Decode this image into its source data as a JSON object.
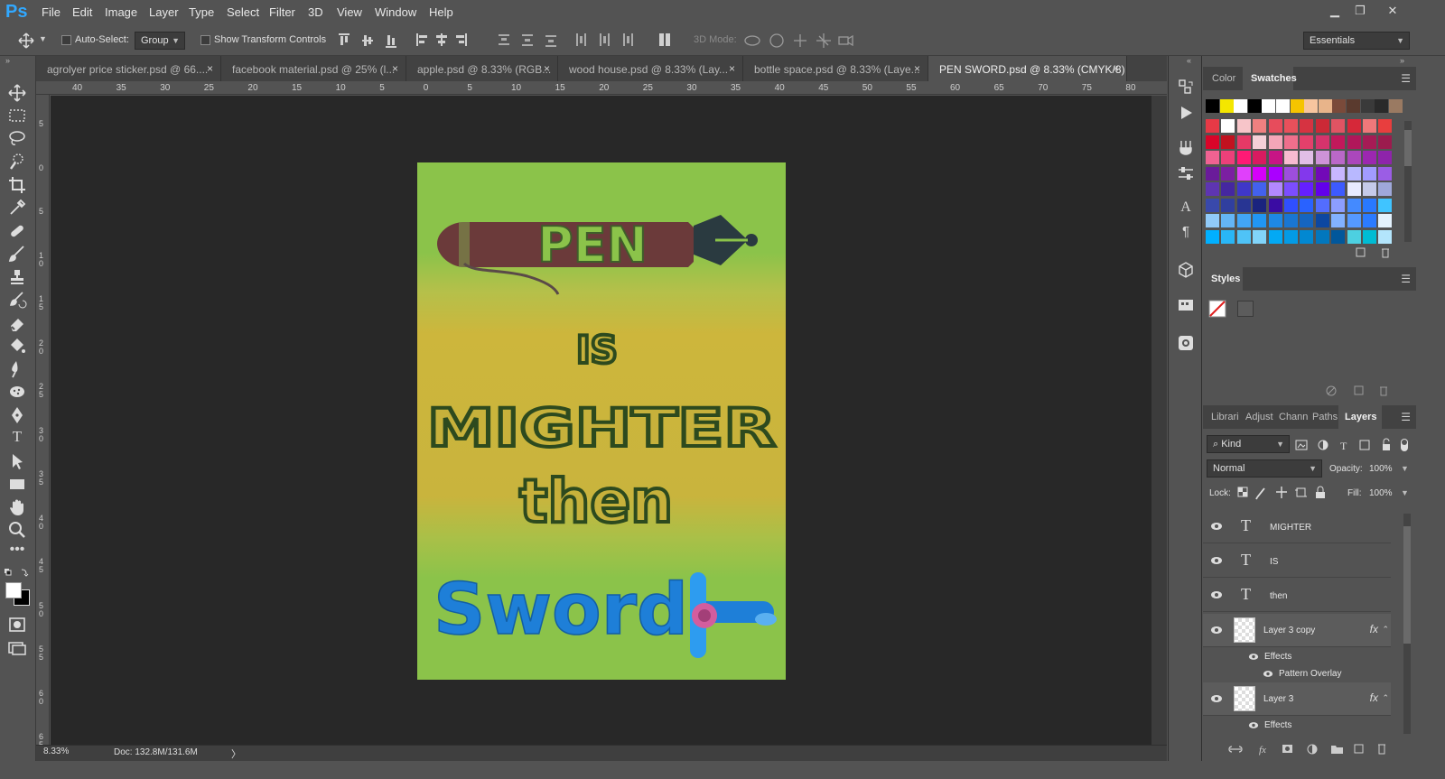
{
  "app": {
    "logo": "Ps"
  },
  "menu": [
    "File",
    "Edit",
    "Image",
    "Layer",
    "Type",
    "Select",
    "Filter",
    "3D",
    "View",
    "Window",
    "Help"
  ],
  "options": {
    "auto_select_label": "Auto-Select:",
    "auto_select_value": "Group",
    "show_transform_label": "Show Transform Controls",
    "mode_3d_label": "3D Mode:",
    "workspace": "Essentials"
  },
  "tabs": [
    {
      "label": "agrolyer price sticker.psd @ 66....",
      "active": false
    },
    {
      "label": "facebook material.psd @ 25% (l...",
      "active": false
    },
    {
      "label": "apple.psd @ 8.33% (RGB...",
      "active": false
    },
    {
      "label": "wood house.psd @ 8.33% (Lay...",
      "active": false
    },
    {
      "label": "bottle space.psd @ 8.33% (Laye...",
      "active": false
    },
    {
      "label": "PEN SWORD.psd @ 8.33% (CMYK/8)",
      "active": true
    }
  ],
  "tab_close": "×",
  "ruler": {
    "top": [
      "40",
      "35",
      "30",
      "25",
      "20",
      "15",
      "10",
      "5",
      "0",
      "5",
      "10",
      "15",
      "20",
      "25",
      "30",
      "35",
      "40",
      "45",
      "50",
      "55",
      "60",
      "65",
      "70",
      "75",
      "80"
    ],
    "left": [
      "5",
      "0",
      "5",
      "1\n0",
      "1\n5",
      "2\n0",
      "2\n5",
      "3\n0",
      "3\n5",
      "4\n0",
      "4\n5",
      "5\n0",
      "5\n5",
      "6\n0",
      "6\n5"
    ]
  },
  "artwork": {
    "pen_word": "PEN",
    "is_word": "IS",
    "mighter_word": "MIGHTER",
    "then_word": "then",
    "sword_word": "Sword"
  },
  "status": {
    "zoom": "8.33%",
    "doc": "Doc: 132.8M/131.6M",
    "arrow": "〉"
  },
  "panels": {
    "color_tabs": [
      "Color",
      "Swatches"
    ],
    "active_color_tab": "Swatches",
    "styles_tab": "Styles",
    "layer_tabs": [
      "Librari",
      "Adjust",
      "Chann",
      "Paths",
      "Layers"
    ],
    "active_layer_tab": "Layers",
    "filter_kind": "Kind",
    "blend_mode": "Normal",
    "opacity_label": "Opacity:",
    "opacity_value": "100%",
    "lock_label": "Lock:",
    "fill_label": "Fill:",
    "fill_value": "100%"
  },
  "swatch_row1": [
    "#000000",
    "#f4e600",
    "#ffffff",
    "#000000",
    "#ffffff",
    "#ffffff",
    "#f5c400",
    "#f7c59f",
    "#e8b48a",
    "#7a4a3a",
    "#5a3a2e",
    "#3a3a3a",
    "#2a2a2a",
    "#9a7a62"
  ],
  "swatches": [
    [
      "#e63946",
      "#ffffff",
      "#f7c5c9",
      "#f08080",
      "#e74c5c",
      "#e8505b",
      "#d63341",
      "#cc2936",
      "#e05463",
      "#d62839",
      "#f0787a",
      "#e83e3e"
    ],
    [
      "#d90429",
      "#c1121f",
      "#e63966",
      "#f5d0d8",
      "#f4a6b8",
      "#ef6f8c",
      "#e4406b",
      "#d6336c",
      "#c2185b",
      "#b0175a",
      "#a61b55",
      "#9c1b4e"
    ],
    [
      "#f06292",
      "#ec407a",
      "#ff1a75",
      "#d81b60",
      "#c71585",
      "#f8bbd0",
      "#e1bee7",
      "#ce93d8",
      "#ba68c8",
      "#ab47bc",
      "#9c27b0",
      "#8e24aa"
    ],
    [
      "#6a1b9a",
      "#7b1fa2",
      "#e040fb",
      "#d500f9",
      "#aa00ff",
      "#9d4edd",
      "#8338ec",
      "#7209b7",
      "#c8b6ff",
      "#b8b8ff",
      "#a29bfe",
      "#9b5de5"
    ],
    [
      "#5e35b1",
      "#4527a0",
      "#3f37c9",
      "#4361ee",
      "#b388ff",
      "#7c4dff",
      "#651fff",
      "#6200ea",
      "#3d5afe",
      "#e8eaff",
      "#c5cae9",
      "#9fa8da"
    ],
    [
      "#3949ab",
      "#303f9f",
      "#283593",
      "#1a237e",
      "#3a0ca3",
      "#304ffe",
      "#2962ff",
      "#536dfe",
      "#8c9eff",
      "#448aff",
      "#2979ff",
      "#40c4ff"
    ],
    [
      "#90caf9",
      "#64b5f6",
      "#42a5f5",
      "#2196f3",
      "#1e88e5",
      "#1976d2",
      "#1565c0",
      "#0d47a1",
      "#82b1ff",
      "#5599ff",
      "#2b7bff",
      "#e3f2fd"
    ],
    [
      "#00b0ff",
      "#29b6f6",
      "#4fc3f7",
      "#81d4fa",
      "#03a9f4",
      "#039be5",
      "#0288d1",
      "#0277bd",
      "#01579b",
      "#4dd0e1",
      "#00bcd4",
      "#b3e5fc"
    ]
  ],
  "layers": [
    {
      "name": "MIGHTER",
      "type": "text"
    },
    {
      "name": "IS",
      "type": "text"
    },
    {
      "name": "then",
      "type": "text"
    },
    {
      "name": "Layer 3 copy",
      "type": "pixel",
      "fx": true
    },
    {
      "name": "Layer 3",
      "type": "pixel",
      "fx": true
    }
  ],
  "effects": {
    "label": "Effects",
    "pattern_overlay": "Pattern Overlay"
  },
  "fx_symbol": "fx",
  "colors": {
    "artboard_green": "#8bc34a",
    "band_yellow": "#c8b43a",
    "text_dark": "#2d4a1e",
    "pen_body": "#6b3a3a",
    "sword_blue": "#1e7fd8",
    "ps_blue": "#31a8ff"
  }
}
